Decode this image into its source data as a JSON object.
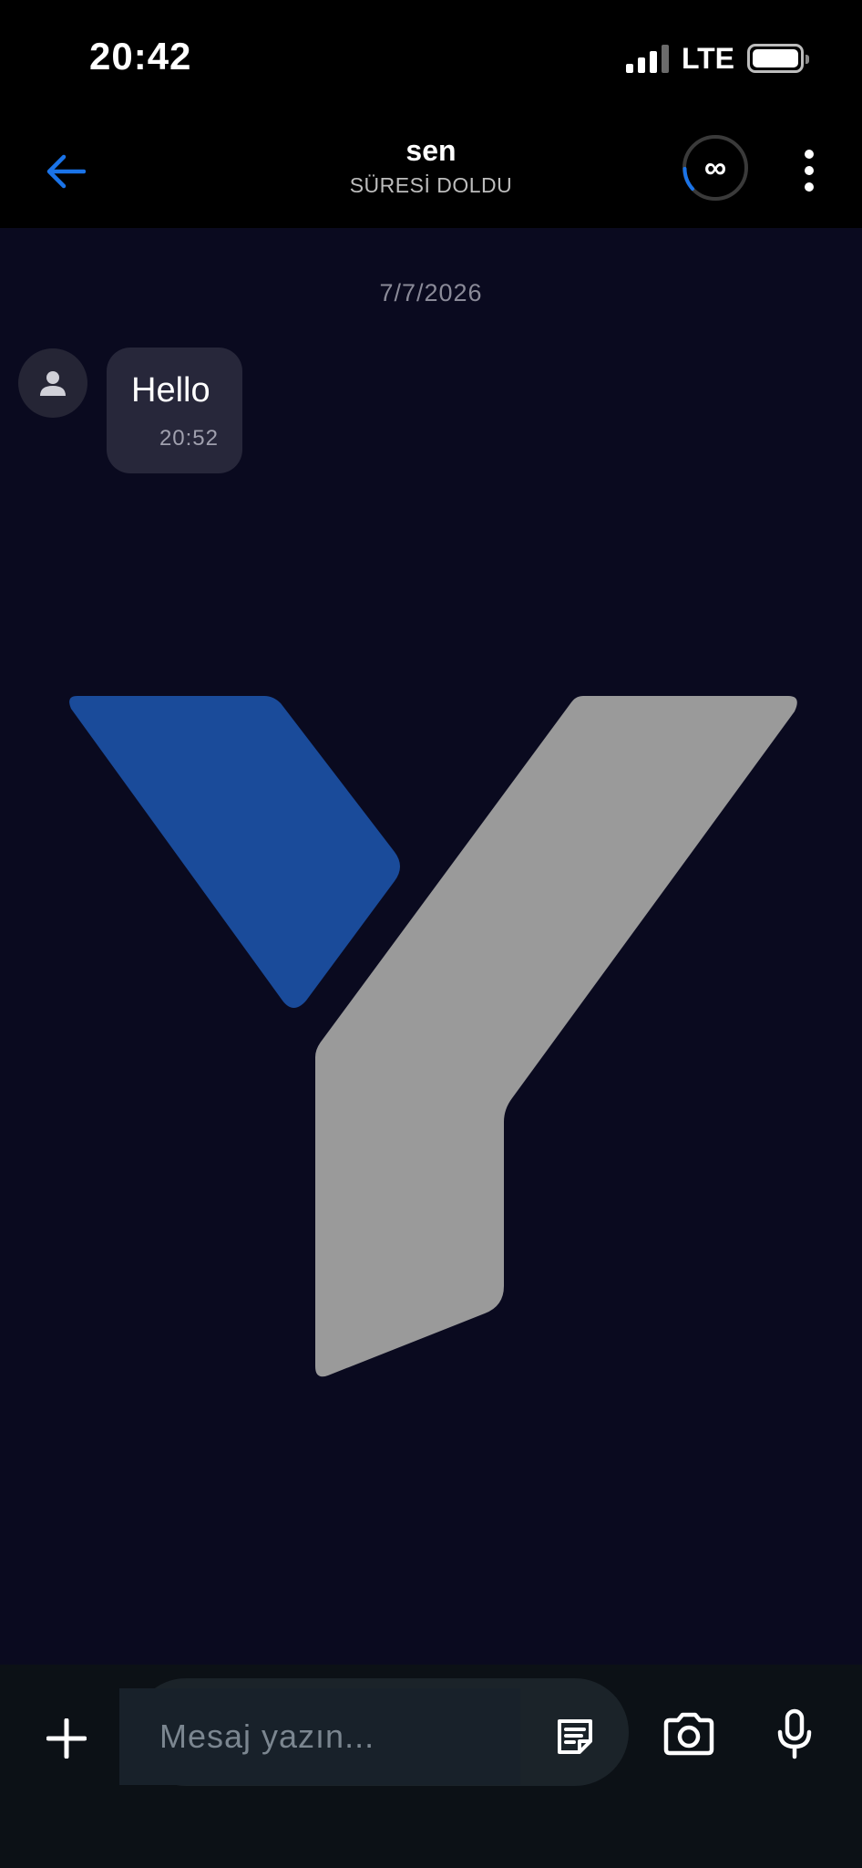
{
  "status_bar": {
    "time": "20:42",
    "network": "LTE",
    "signal_bars": 4,
    "signal_bars_active": 3
  },
  "header": {
    "title": "sen",
    "subtitle": "SÜRESİ DOLDU",
    "timer_label": "∞",
    "accent_color": "#1a73e8"
  },
  "chat": {
    "date_separator": "7/7/2026",
    "messages": [
      {
        "text": "Hello",
        "time": "20:52",
        "direction": "incoming"
      }
    ],
    "watermark": {
      "left_color": "#1a4b9a",
      "right_color": "#9a9a9a"
    }
  },
  "composer": {
    "placeholder": "Mesaj yazın...",
    "icons": [
      "plus-icon",
      "note-icon",
      "camera-icon",
      "microphone-icon"
    ]
  },
  "colors": {
    "background": "#0a0a1f",
    "bubble": "#27273a",
    "composer": "#0c1116"
  }
}
